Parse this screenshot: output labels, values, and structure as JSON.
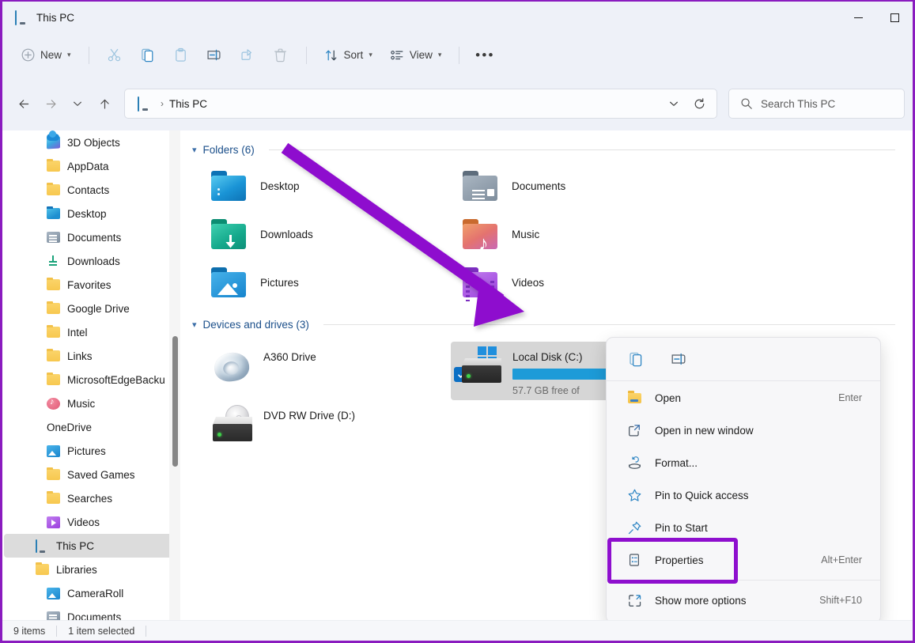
{
  "window": {
    "title": "This PC",
    "title_icon": "this-pc-monitor-icon",
    "controls": {
      "minimize": "minimize",
      "maximize": "maximize"
    }
  },
  "toolbar": {
    "new_label": "New",
    "sort_label": "Sort",
    "view_label": "View",
    "overflow_label": "•••",
    "icons": [
      "cut-icon",
      "copy-icon",
      "paste-icon",
      "rename-icon",
      "share-icon",
      "delete-icon"
    ]
  },
  "address": {
    "back": "←",
    "forward": "→",
    "recent": "⌄",
    "up": "↑",
    "breadcrumb_icon": "this-pc-monitor-icon",
    "breadcrumb_separator": "›",
    "breadcrumb_text": "This PC",
    "dropdown": "⌄",
    "refresh": "refresh-icon"
  },
  "search": {
    "icon": "search-icon",
    "placeholder": "Search This PC"
  },
  "sidebar": {
    "items": [
      {
        "label": "3D Objects",
        "icon": "cube-icon",
        "kind": "ic-3d",
        "indent": 1
      },
      {
        "label": "AppData",
        "icon": "folder-icon",
        "kind": "ic-folder",
        "indent": 1
      },
      {
        "label": "Contacts",
        "icon": "folder-icon",
        "kind": "ic-folder",
        "indent": 1
      },
      {
        "label": "Desktop",
        "icon": "desktop-icon",
        "kind": "ic-desktop",
        "indent": 1
      },
      {
        "label": "Documents",
        "icon": "documents-icon",
        "kind": "ic-doc",
        "indent": 1
      },
      {
        "label": "Downloads",
        "icon": "download-icon",
        "kind": "ic-down",
        "indent": 1
      },
      {
        "label": "Favorites",
        "icon": "folder-icon",
        "kind": "ic-folder",
        "indent": 1
      },
      {
        "label": "Google Drive",
        "icon": "folder-icon",
        "kind": "ic-folder",
        "indent": 1
      },
      {
        "label": "Intel",
        "icon": "folder-icon",
        "kind": "ic-folder",
        "indent": 1
      },
      {
        "label": "Links",
        "icon": "folder-icon",
        "kind": "ic-folder",
        "indent": 1
      },
      {
        "label": "MicrosoftEdgeBacku",
        "icon": "folder-icon",
        "kind": "ic-folder",
        "indent": 1
      },
      {
        "label": "Music",
        "icon": "music-icon",
        "kind": "ic-music",
        "indent": 1
      },
      {
        "label": "OneDrive",
        "icon": "cloud-icon",
        "kind": "ic-cloud",
        "indent": 1
      },
      {
        "label": "Pictures",
        "icon": "pictures-icon",
        "kind": "ic-pic",
        "indent": 1
      },
      {
        "label": "Saved Games",
        "icon": "folder-icon",
        "kind": "ic-folder",
        "indent": 1
      },
      {
        "label": "Searches",
        "icon": "folder-icon",
        "kind": "ic-folder",
        "indent": 1
      },
      {
        "label": "Videos",
        "icon": "videos-icon",
        "kind": "ic-vid",
        "indent": 1
      },
      {
        "label": "This PC",
        "icon": "this-pc-monitor-icon",
        "kind": "ic-pc",
        "indent": 0,
        "selected": true
      },
      {
        "label": "Libraries",
        "icon": "folder-icon",
        "kind": "ic-folder",
        "indent": 0
      },
      {
        "label": "CameraRoll",
        "icon": "pictures-icon",
        "kind": "ic-pic",
        "indent": 1
      },
      {
        "label": "Documents",
        "icon": "documents-icon",
        "kind": "ic-doc",
        "indent": 1
      }
    ]
  },
  "content": {
    "folders_group": {
      "chevron": "⌄",
      "title": "Folders (6)",
      "items": [
        {
          "label": "Desktop",
          "icon": "desktop-folder-icon"
        },
        {
          "label": "Documents",
          "icon": "documents-folder-icon"
        },
        {
          "label": "Downloads",
          "icon": "downloads-folder-icon"
        },
        {
          "label": "Music",
          "icon": "music-folder-icon"
        },
        {
          "label": "Pictures",
          "icon": "pictures-folder-icon"
        },
        {
          "label": "Videos",
          "icon": "videos-folder-icon"
        }
      ]
    },
    "drives_group": {
      "chevron": "⌄",
      "title": "Devices and drives (3)",
      "items": [
        {
          "label": "A360 Drive",
          "icon": "a360-drive-icon",
          "has_bar": false,
          "selected": false
        },
        {
          "label": "Local Disk (C:)",
          "icon": "local-disk-icon",
          "has_bar": true,
          "selected": true,
          "free_text": "57.7 GB free of",
          "used_percent": 72
        },
        {
          "label": "DVD RW Drive (D:)",
          "icon": "dvd-drive-icon",
          "has_bar": false,
          "selected": false
        }
      ]
    }
  },
  "context_menu": {
    "top_icons": [
      {
        "name": "copy-icon"
      },
      {
        "name": "rename-icon"
      }
    ],
    "items": [
      {
        "label": "Open",
        "icon": "folder-open-icon",
        "shortcut": "Enter",
        "highlighted": false
      },
      {
        "label": "Open in new window",
        "icon": "open-new-window-icon",
        "shortcut": "",
        "highlighted": false
      },
      {
        "label": "Format...",
        "icon": "format-disk-icon",
        "shortcut": "",
        "highlighted": false
      },
      {
        "label": "Pin to Quick access",
        "icon": "star-icon",
        "shortcut": "",
        "highlighted": false
      },
      {
        "label": "Pin to Start",
        "icon": "pin-icon",
        "shortcut": "",
        "highlighted": false
      },
      {
        "label": "Properties",
        "icon": "properties-icon",
        "shortcut": "Alt+Enter",
        "highlighted": true
      },
      {
        "label": "Show more options",
        "icon": "show-more-options-icon",
        "shortcut": "Shift+F10",
        "highlighted": false
      }
    ]
  },
  "annotation": {
    "color": "#8e0fce",
    "arrow": "purple-arrow-pointing-to-local-disk",
    "highlight": "purple-box-around-properties"
  },
  "statusbar": {
    "item_count": "9 items",
    "selection": "1 item selected"
  },
  "colors": {
    "accent": "#1d9bd8",
    "annotation_purple": "#8e0fce",
    "chrome": "#eef1f8",
    "selection": "#d6d6d6"
  }
}
